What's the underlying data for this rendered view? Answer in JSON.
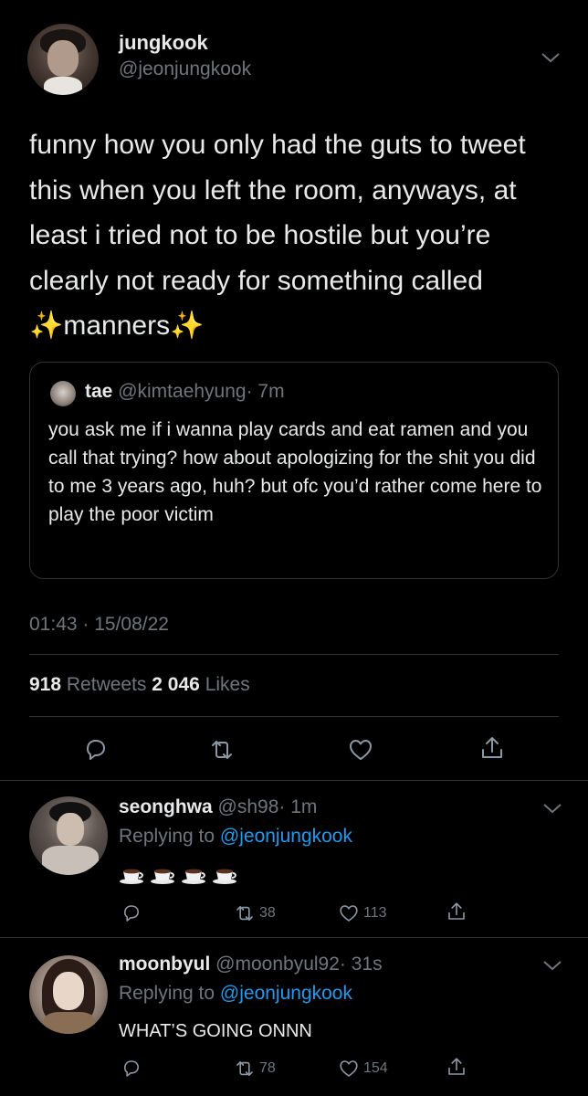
{
  "tweet": {
    "author_name": "jungkook",
    "author_handle": "@jeonjungkook",
    "text_parts": [
      "funny how you only had the guts to tweet this when you left the room, anyways, at least i tried not to be hostile but you’re clearly not ready for something called ",
      "✨",
      "manners",
      "✨"
    ],
    "timestamp": "01:43 · 15/08/22",
    "retweets_count": "918",
    "retweets_label": "Retweets",
    "likes_count": "2 046",
    "likes_label": "Likes"
  },
  "quoted_tweet": {
    "author_name": "tae",
    "author_handle": "@kimtaehyung",
    "time": "· 7m",
    "text": "you ask me if i wanna play cards and eat ramen and you call that trying? how about apologizing for the shit you did to me 3 years ago, huh? but ofc you’d rather come here to play the poor victim"
  },
  "replies": [
    {
      "author_name": "seonghwa",
      "author_handle": "@sh98",
      "time": "· 1m",
      "replying_label": "Replying to",
      "replying_to": "@jeonjungkook",
      "content_icons": [
        "coffee-cup",
        "coffee-cup",
        "coffee-cup",
        "coffee-cup"
      ],
      "retweets": "38",
      "likes": "113"
    },
    {
      "author_name": "moonbyul",
      "author_handle": "@moonbyul92",
      "time": "· 31s",
      "replying_label": "Replying to",
      "replying_to": "@jeonjungkook",
      "text": "WHAT’S GOING ONNN",
      "retweets": "78",
      "likes": "154"
    }
  ],
  "icons": {
    "reply": "reply-icon",
    "retweet": "retweet-icon",
    "like": "heart-icon",
    "share": "share-icon",
    "more": "chevron-down-icon"
  },
  "colors": {
    "background": "#000000",
    "text": "#e7e9ea",
    "secondary": "#6e767d",
    "link": "#1d9bf0",
    "divider": "#2f3336"
  }
}
